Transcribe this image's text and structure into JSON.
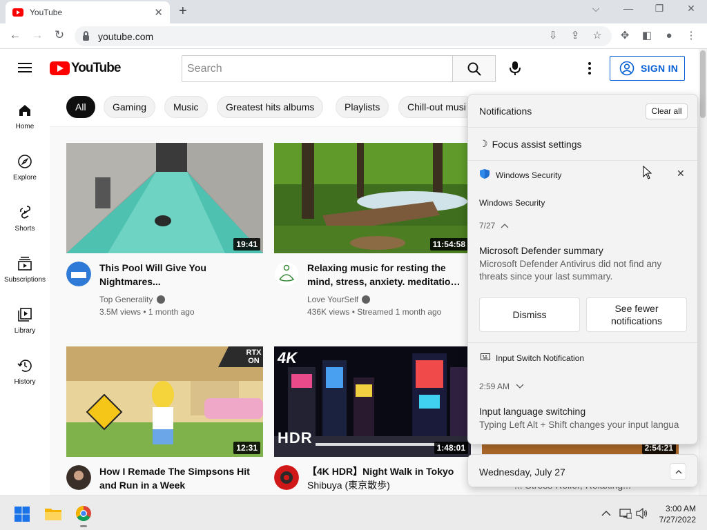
{
  "browser": {
    "tab_title": "YouTube",
    "url": "youtube.com"
  },
  "youtube": {
    "logo_text": "YouTube",
    "search_placeholder": "Search",
    "sign_in_label": "SIGN IN",
    "sidebar": [
      {
        "label": "Home",
        "icon": "home-icon"
      },
      {
        "label": "Explore",
        "icon": "compass-icon"
      },
      {
        "label": "Shorts",
        "icon": "shorts-icon"
      },
      {
        "label": "Subscriptions",
        "icon": "subscriptions-icon"
      },
      {
        "label": "Library",
        "icon": "library-icon"
      },
      {
        "label": "History",
        "icon": "history-icon"
      }
    ],
    "chips": [
      "All",
      "Gaming",
      "Music",
      "Greatest hits albums",
      "Playlists",
      "Chill-out musi"
    ],
    "videos": [
      {
        "title1": "This Pool Will Give You",
        "title2": "Nightmares...",
        "channel": "Top Generality",
        "meta": "3.5M views • 1 month ago",
        "duration": "19:41"
      },
      {
        "title1": "Relaxing music for resting the",
        "title2": "mind, stress, anxiety. meditation...",
        "channel": "Love YourSelf",
        "meta": "436K views • Streamed 1 month ago",
        "duration": "11:54:58"
      },
      {
        "title1": "How I Remade The Simpsons Hit",
        "title2": "and Run in a Week",
        "duration": "12:31",
        "badge": "RTX ON"
      },
      {
        "title1": "【4K HDR】Night Walk in Tokyo",
        "title2": "Shibuya (東京散歩)",
        "duration": "1:48:01",
        "badge": "4K",
        "badge2": "HDR"
      },
      {
        "duration": "2:54:21",
        "partial_title": "... Stress Relief, Relaxing..."
      }
    ]
  },
  "notifications": {
    "header": "Notifications",
    "clear_all": "Clear all",
    "focus_assist": "Focus assist settings",
    "app1_name": "Windows Security",
    "app1_group": "Windows Security",
    "app1_date": "7/27",
    "app1_title": "Microsoft Defender summary",
    "app1_body": "Microsoft Defender Antivirus did not find any threats since your last summary.",
    "dismiss": "Dismiss",
    "see_fewer": "See fewer notifications",
    "app2_name": "Input Switch Notification",
    "app2_time": "2:59 AM",
    "app2_title": "Input language switching",
    "app2_body": "Typing Left Alt + Shift changes your input langua",
    "date_bar": "Wednesday, July 27"
  },
  "taskbar": {
    "time": "3:00 AM",
    "date": "7/27/2022"
  },
  "colors": {
    "youtube_red": "#ff0000",
    "link_blue": "#065fd4"
  }
}
